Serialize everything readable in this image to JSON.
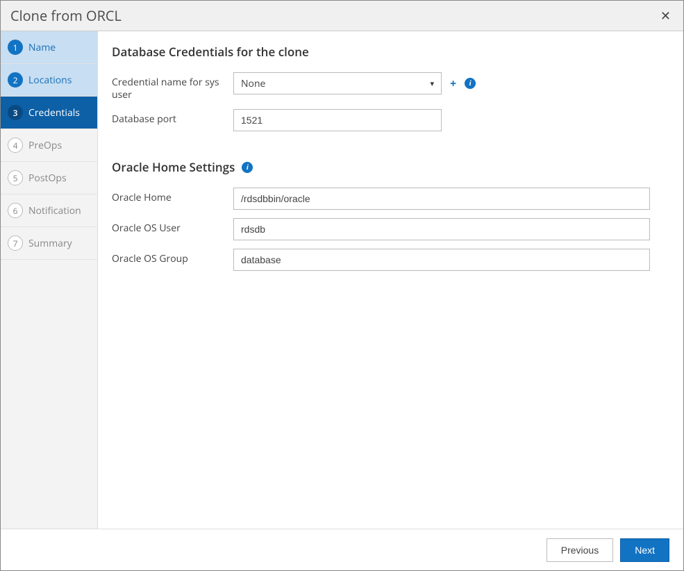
{
  "header": {
    "title": "Clone from ORCL",
    "close_glyph": "✕"
  },
  "sidebar": {
    "steps": [
      {
        "num": "1",
        "label": "Name"
      },
      {
        "num": "2",
        "label": "Locations"
      },
      {
        "num": "3",
        "label": "Credentials"
      },
      {
        "num": "4",
        "label": "PreOps"
      },
      {
        "num": "5",
        "label": "PostOps"
      },
      {
        "num": "6",
        "label": "Notification"
      },
      {
        "num": "7",
        "label": "Summary"
      }
    ]
  },
  "main": {
    "section1_title": "Database Credentials for the clone",
    "cred_label": "Credential name for sys user",
    "cred_value": "None",
    "port_label": "Database port",
    "port_value": "1521",
    "section2_title": "Oracle Home Settings",
    "oh_label": "Oracle Home",
    "oh_value": "/rdsdbbin/oracle",
    "osuser_label": "Oracle OS User",
    "osuser_value": "rdsdb",
    "osgroup_label": "Oracle OS Group",
    "osgroup_value": "database"
  },
  "footer": {
    "previous": "Previous",
    "next": "Next"
  },
  "glyphs": {
    "plus": "+",
    "info": "i",
    "caret": "▾"
  }
}
